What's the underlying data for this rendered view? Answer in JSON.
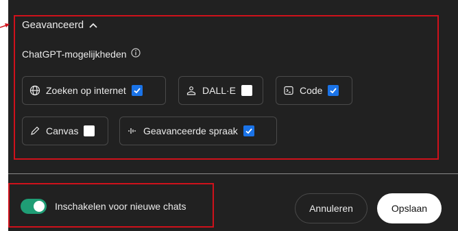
{
  "advanced": {
    "title": "Geavanceerd"
  },
  "capabilities": {
    "label": "ChatGPT-mogelijkheden",
    "items": [
      {
        "label": "Zoeken op internet",
        "icon": "globe-icon",
        "checked": true
      },
      {
        "label": "DALL·E",
        "icon": "image-icon",
        "checked": false
      },
      {
        "label": "Code",
        "icon": "terminal-icon",
        "checked": true
      },
      {
        "label": "Canvas",
        "icon": "pencil-icon",
        "checked": false
      },
      {
        "label": "Geavanceerde spraak",
        "icon": "voice-wave-icon",
        "checked": true
      }
    ]
  },
  "footer": {
    "toggle_label": "Inschakelen voor nieuwe chats",
    "toggle_on": true,
    "cancel_label": "Annuleren",
    "save_label": "Opslaan"
  },
  "colors": {
    "background": "#212121",
    "highlight": "#d0111b",
    "checkbox_checked": "#1a73e8",
    "toggle_on": "#1f9d75"
  }
}
